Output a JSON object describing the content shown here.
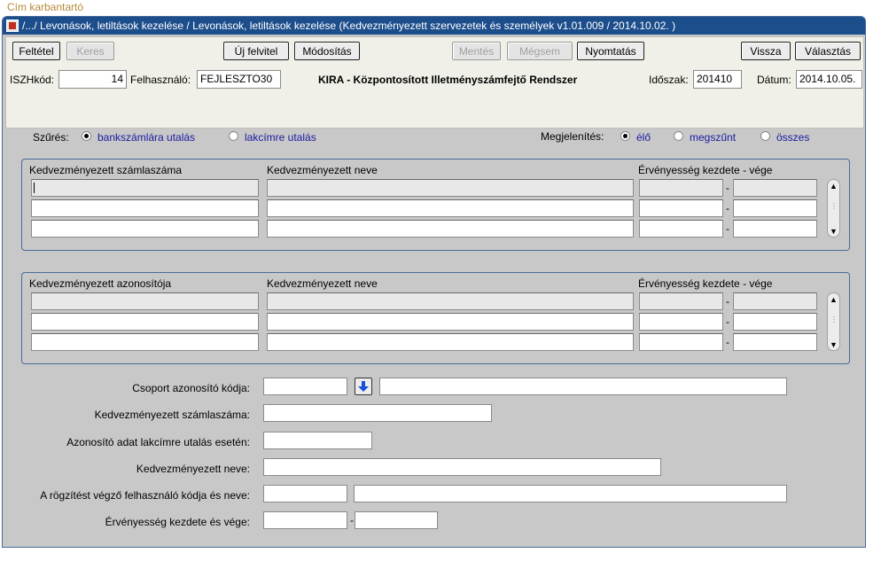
{
  "outer_title": "Cím karbantartó",
  "window_title": "/.../ Levonások, letiltások kezelése / Levonások, letiltások kezelése (Kedvezményezett szervezetek és személyek v1.01.009 / 2014.10.02. )",
  "toolbar": {
    "felt_label": "Feltétel",
    "keres_label": "Keres",
    "uj_label": "Új felvitel",
    "modositas_label": "Módosítás",
    "mentes_label": "Mentés",
    "megsem_label": "Mégsem",
    "nyomtatas_label": "Nyomtatás",
    "vissza_label": "Vissza",
    "valasztas_label": "Választás"
  },
  "header": {
    "iszh_label": "ISZHkód:",
    "iszh_value": "14",
    "user_label": "Felhasználó:",
    "user_value": "FEJLESZTO30",
    "system_title": "KIRA - Központosított Illetményszámfejtő Rendszer",
    "period_label": "Időszak:",
    "period_value": "201410",
    "date_label": "Dátum:",
    "date_value": "2014.10.05."
  },
  "filter": {
    "label": "Szűrés:",
    "opt1": "bankszámlára utalás",
    "opt2": "lakcímre utalás",
    "selected": "bankszámlára utalás"
  },
  "display": {
    "label": "Megjelenítés:",
    "opt1": "élő",
    "opt2": "megszűnt",
    "opt3": "összes",
    "selected": "élő"
  },
  "block1": {
    "col1": "Kedvezményezett számlaszáma",
    "col2": "Kedvezményezett neve",
    "col3": "Érvényesség kezdete - vége",
    "dash": "-"
  },
  "block2": {
    "col1": "Kedvezményezett azonosítója",
    "col2": "Kedvezményezett neve",
    "col3": "Érvényesség kezdete - vége",
    "dash": "-"
  },
  "form": {
    "group_label": "Csoport azonosító kódja:",
    "account_label": "Kedvezményezett számlaszáma:",
    "address_id_label": "Azonosító adat lakcímre utalás esetén:",
    "name_label": "Kedvezményezett neve:",
    "recorder_label": "A rögzítést végző felhasználó kódja és neve:",
    "validity_label": "Érvényesség kezdete és vége:",
    "dash": "-"
  },
  "colors": {
    "titlebar": "#1c4e8c",
    "window_bg": "#c8c8c8",
    "radio_text": "#1a1aa0",
    "outer_title": "#b58a3a"
  }
}
